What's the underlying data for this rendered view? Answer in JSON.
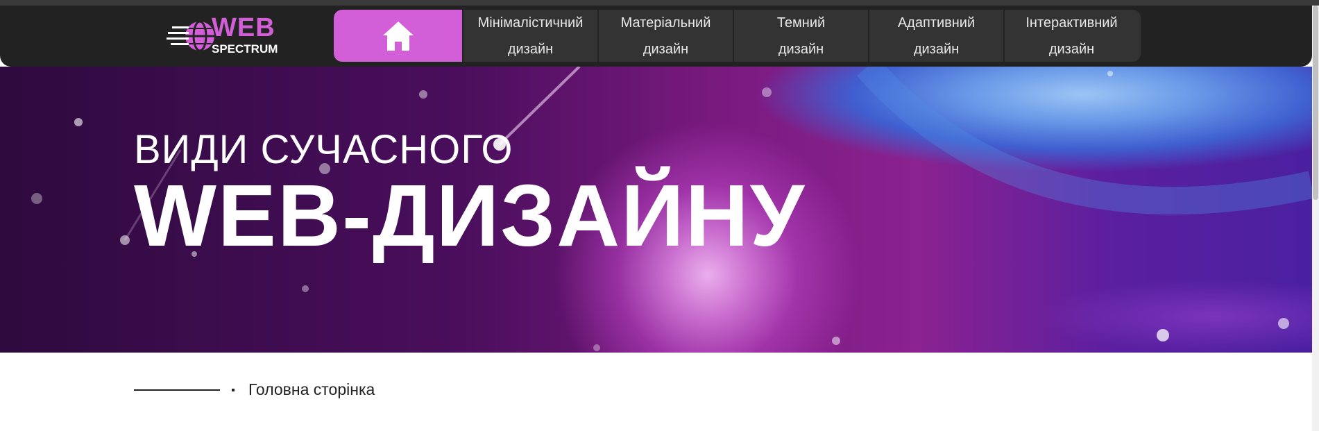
{
  "brand": {
    "logo_primary": "WEB",
    "logo_secondary": "SPECTRUM",
    "accent_color": "#d25fd8",
    "icon": "globe-speed-icon"
  },
  "nav": {
    "home_icon": "home-icon",
    "items": [
      {
        "line1": "Мінімалістичний",
        "line2": "дизайн"
      },
      {
        "line1": "Матеріальний",
        "line2": "дизайн"
      },
      {
        "line1": "Темний",
        "line2": "дизайн"
      },
      {
        "line1": "Адаптивний",
        "line2": "дизайн"
      },
      {
        "line1": "Інтерактивний",
        "line2": "дизайн"
      }
    ]
  },
  "hero": {
    "subtitle": "ВИДИ СУЧАСНОГО",
    "title": "WEB-ДИЗАЙНУ"
  },
  "breadcrumb": {
    "label": "Головна сторінка"
  }
}
